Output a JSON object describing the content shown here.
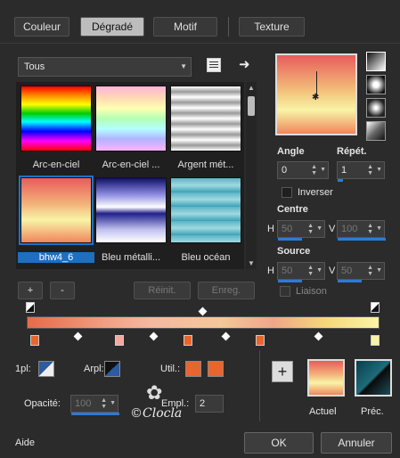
{
  "tabs": [
    {
      "label": "Couleur"
    },
    {
      "label": "Dégradé"
    },
    {
      "label": "Motif"
    },
    {
      "label": "Texture"
    }
  ],
  "filter": {
    "selected": "Tous"
  },
  "gradients": [
    {
      "label": "Arc-en-ciel"
    },
    {
      "label": "Arc-en-ciel ..."
    },
    {
      "label": "Argent mét..."
    },
    {
      "label": "bhw4_6"
    },
    {
      "label": "Bleu métalli..."
    },
    {
      "label": "Bleu océan"
    }
  ],
  "actions": {
    "add": "+",
    "remove": "-",
    "reset": "Réinit.",
    "save": "Enreg."
  },
  "angle": {
    "label": "Angle",
    "value": "0"
  },
  "repeat": {
    "label": "Répét.",
    "value": "1"
  },
  "invert": {
    "label": "Inverser"
  },
  "center": {
    "label": "Centre",
    "h_label": "H",
    "h_value": "50",
    "v_label": "V",
    "v_value": "100"
  },
  "source": {
    "label": "Source",
    "h_label": "H",
    "h_value": "50",
    "v_label": "V",
    "v_value": "50"
  },
  "link": {
    "label": "Liaison"
  },
  "stop_props": {
    "first_plan_label": "1pl:",
    "second_plan_label": "Arpl:",
    "user_label": "Util.:",
    "opacity_label": "Opacité:",
    "opacity_value": "100",
    "location_label": "Empl.:",
    "location_value": "2"
  },
  "swatches": {
    "current_label": "Actuel",
    "previous_label": "Préc."
  },
  "footer": {
    "help": "Aide",
    "ok": "OK",
    "cancel": "Annuler"
  },
  "watermark": {
    "text": "©Clocla"
  },
  "colors": {
    "accent": "#1e73c8",
    "user_color": "#e8662e"
  }
}
